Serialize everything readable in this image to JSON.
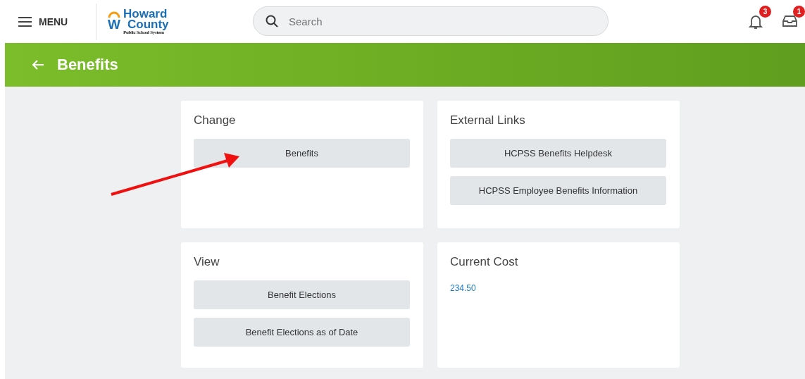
{
  "header": {
    "menu_label": "MENU",
    "logo": {
      "letter": "W",
      "line_1": "Howard",
      "line_2": "County",
      "line_3": "Public School System"
    },
    "search": {
      "placeholder": "Search"
    },
    "notifications": {
      "count": "3"
    },
    "inbox": {
      "count": "1"
    }
  },
  "page_title": "Benefits",
  "cards": [
    {
      "title": "Change",
      "buttons": [
        "Benefits"
      ]
    },
    {
      "title": "External Links",
      "buttons": [
        "HCPSS Benefits Helpdesk",
        "HCPSS Employee Benefits Information"
      ]
    },
    {
      "title": "View",
      "buttons": [
        "Benefit Elections",
        "Benefit Elections as of Date"
      ]
    },
    {
      "title": "Current Cost",
      "value": "234.50"
    }
  ]
}
